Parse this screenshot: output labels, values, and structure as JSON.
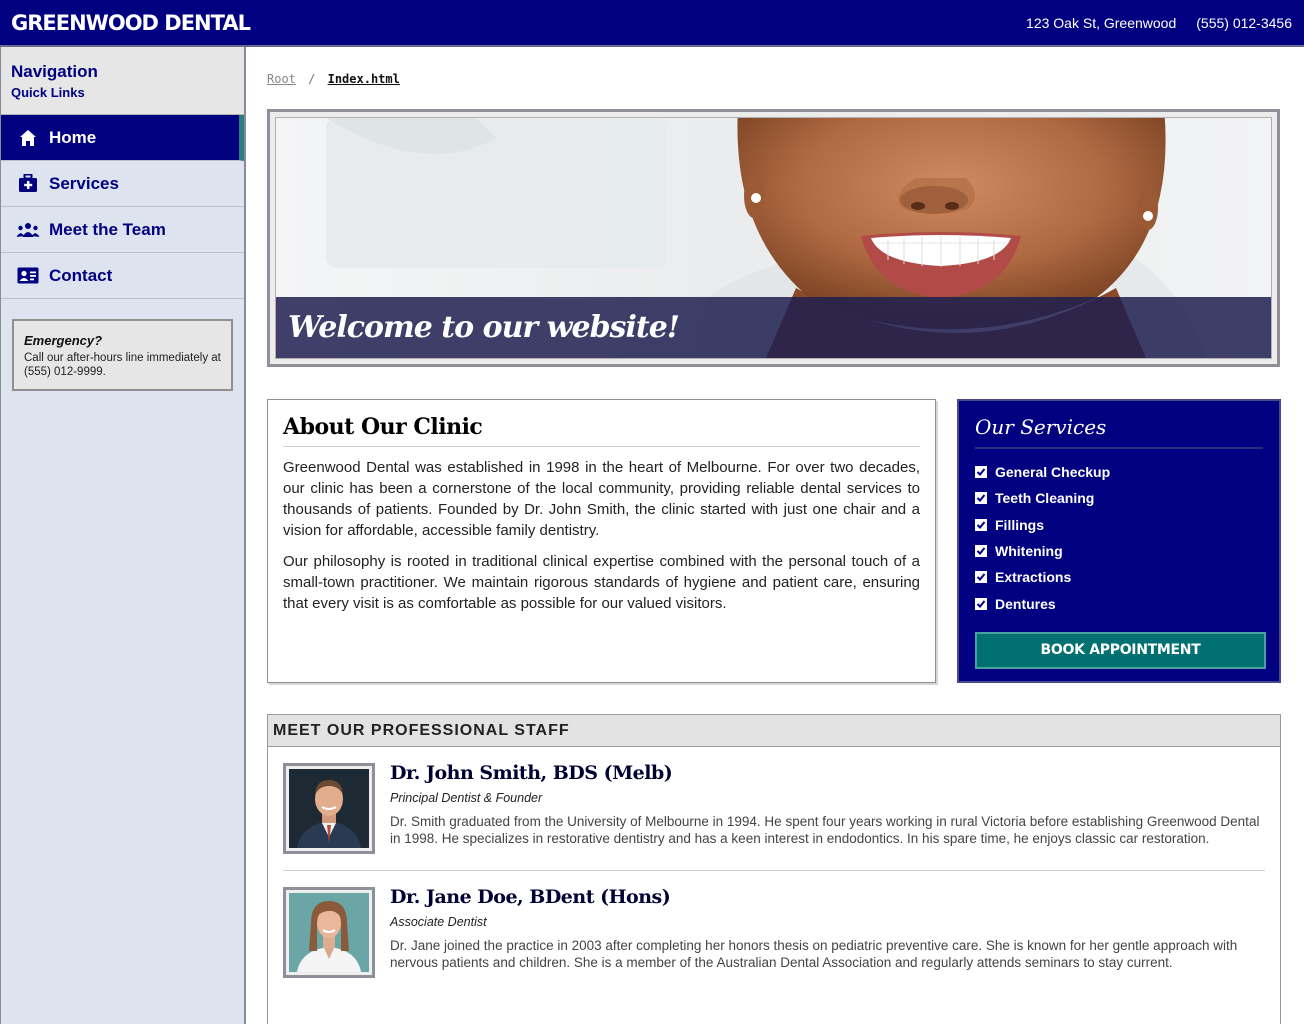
{
  "header": {
    "brand": "GREENWOOD DENTAL",
    "address": "123 Oak St, Greenwood",
    "phone": "(555) 012-3456"
  },
  "sidebar": {
    "title": "Navigation",
    "subtitle": "Quick Links",
    "items": [
      {
        "label": "Home",
        "icon": "home-icon",
        "active": true
      },
      {
        "label": "Services",
        "icon": "medical-bag-icon",
        "active": false
      },
      {
        "label": "Meet the Team",
        "icon": "people-icon",
        "active": false
      },
      {
        "label": "Contact",
        "icon": "contact-card-icon",
        "active": false
      }
    ],
    "emergency": {
      "title": "Emergency?",
      "text": "Call our after-hours line immediately at (555) 012-9999."
    }
  },
  "breadcrumb": {
    "root": "Root",
    "separator": "/",
    "current": "Index.html"
  },
  "hero": {
    "banner": "Welcome to our website!"
  },
  "about": {
    "title": "About Our Clinic",
    "paragraphs": [
      "Greenwood Dental was established in 1998 in the heart of Melbourne. For over two decades, our clinic has been a cornerstone of the local community, providing reliable dental services to thousands of patients. Founded by Dr. John Smith, the clinic started with just one chair and a vision for affordable, accessible family dentistry.",
      "Our philosophy is rooted in traditional clinical expertise combined with the personal touch of a small-town practitioner. We maintain rigorous standards of hygiene and patient care, ensuring that every visit is as comfortable as possible for our valued visitors."
    ]
  },
  "services": {
    "title": "Our Services",
    "items": [
      "General Checkup",
      "Teeth Cleaning",
      "Fillings",
      "Whitening",
      "Extractions",
      "Dentures"
    ],
    "button": "BOOK APPOINTMENT"
  },
  "staff": {
    "heading": "MEET OUR PROFESSIONAL STAFF",
    "members": [
      {
        "name": "Dr. John Smith, BDS (Melb)",
        "role": "Principal Dentist & Founder",
        "bio": "Dr. Smith graduated from the University of Melbourne in 1994. He spent four years working in rural Victoria before establishing Greenwood Dental in 1998. He specializes in restorative dentistry and has a keen interest in endodontics. In his spare time, he enjoys classic car restoration."
      },
      {
        "name": "Dr. Jane Doe, BDent (Hons)",
        "role": "Associate Dentist",
        "bio": "Dr. Jane joined the practice in 2003 after completing her honors thesis on pediatric preventive care. She is known for her gentle approach with nervous patients and children. She is a member of the Australian Dental Association and regularly attends seminars to stay current."
      }
    ]
  },
  "colors": {
    "primary": "#000080",
    "accent": "#007070",
    "sidebar_bg": "#dde4ef"
  }
}
